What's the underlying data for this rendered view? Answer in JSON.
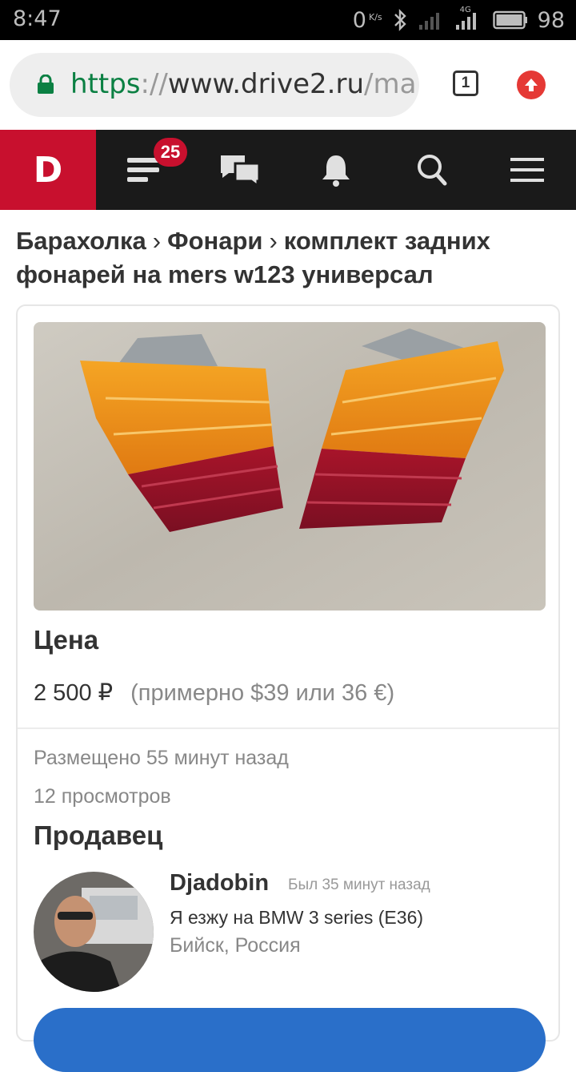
{
  "status_bar": {
    "time": "8:47",
    "net_speed_value": "0",
    "net_speed_unit": "K/s",
    "network_type": "4G",
    "battery": "98"
  },
  "browser": {
    "url_scheme": "https",
    "url_separator": "://",
    "url_host": "www.drive2.ru",
    "url_path": "/mark",
    "tab_count": "1"
  },
  "site_nav": {
    "logo": "D",
    "feed_badge": "25"
  },
  "breadcrumb": {
    "items": [
      "Барахолка",
      "Фонари",
      "комплект задних фонарей на mers w123 универсал"
    ],
    "separator": "›"
  },
  "listing": {
    "price_label": "Цена",
    "price": "2 500 ₽",
    "price_approx": "(примерно $39 или 36 €)",
    "posted": "Размещено 55 минут назад",
    "views": "12 просмотров"
  },
  "seller": {
    "heading": "Продавец",
    "name": "Djadobin",
    "last_seen": "Был 35 минут назад",
    "car": "Я езжу на BMW 3 series (E36)",
    "city": "Бийск, Россия"
  },
  "colors": {
    "brand_red": "#c8102e",
    "nav_dark": "#1a1a1a",
    "button_blue": "#2a6fc9",
    "url_green": "#0b8043"
  }
}
